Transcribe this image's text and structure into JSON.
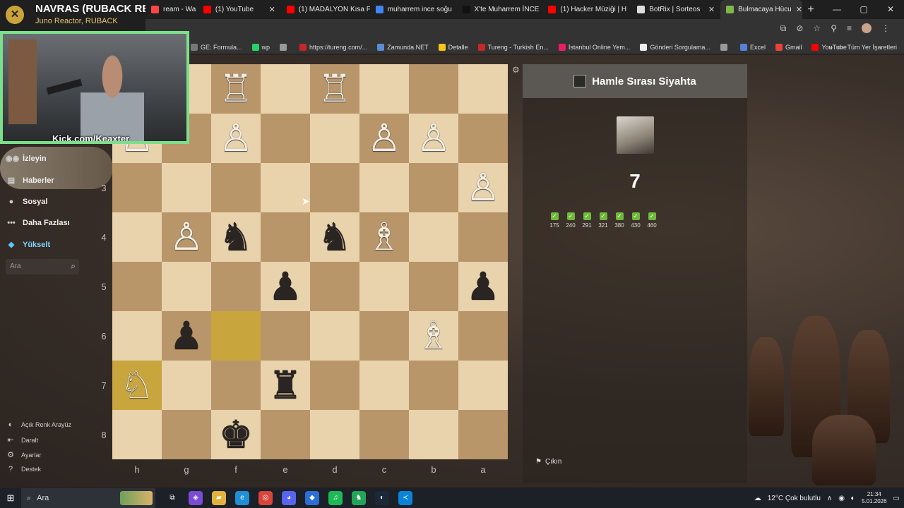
{
  "browser": {
    "tabs": [
      {
        "label": "ream - Wa",
        "icon_color": "#ff4444",
        "active": false
      },
      {
        "label": "(1) YouTube",
        "icon_color": "#ff0000",
        "active": false
      },
      {
        "label": "(1) MADALYON Kısa F",
        "icon_color": "#ff0000",
        "active": false
      },
      {
        "label": "muharrem ince soğu",
        "icon_color": "#4285f4",
        "active": false
      },
      {
        "label": "X'te Muharrem İNCE",
        "icon_color": "#111111",
        "active": false
      },
      {
        "label": "(1) Hacker Müziği | H",
        "icon_color": "#ff0000",
        "active": false
      },
      {
        "label": "BotRix | Sorteos",
        "icon_color": "#dddddd",
        "active": false
      },
      {
        "label": "Bulmacaya Hücu",
        "icon_color": "#81b64c",
        "active": true
      }
    ],
    "new_tab": "+",
    "window_controls": [
      "—",
      "▢",
      "✕"
    ],
    "bookmarks": [
      {
        "label": "GE: Formula...",
        "icon_color": "#777"
      },
      {
        "label": "wp",
        "icon_color": "#25d366"
      },
      {
        "label": "",
        "icon_color": "#999"
      },
      {
        "label": "https://tureng.com/...",
        "icon_color": "#c62828"
      },
      {
        "label": "Zamunda.NET",
        "icon_color": "#5a8dd6"
      },
      {
        "label": "Detalle",
        "icon_color": "#f5c518"
      },
      {
        "label": "Tureng - Turkish En...",
        "icon_color": "#c62828"
      },
      {
        "label": "İstanbul Online Yem...",
        "icon_color": "#e91e63"
      },
      {
        "label": "Gönderi Sorgulama...",
        "icon_color": "#eeeeee"
      },
      {
        "label": "",
        "icon_color": "#999"
      },
      {
        "label": "Excel",
        "icon_color": "#5a7fd6"
      },
      {
        "label": "Gmail",
        "icon_color": "#ea4335"
      },
      {
        "label": "YouTube",
        "icon_color": "#ff0000"
      }
    ],
    "all_bookmarks_label": "Tüm Yer İşaretleri"
  },
  "stream": {
    "title": "NAVRAS (RUBACK REM",
    "subtitle": "Juno Reactor, RUBACK",
    "cam_label": "Kick.com/Keaxter"
  },
  "sidebar": {
    "nav": [
      {
        "label": "İzleyin",
        "icon": "binoculars-icon",
        "glyph": "◉◉"
      },
      {
        "label": "Haberler",
        "icon": "news-icon",
        "glyph": "▤"
      },
      {
        "label": "Sosyal",
        "icon": "social-icon",
        "glyph": "●"
      },
      {
        "label": "Daha Fazlası",
        "icon": "more-icon",
        "glyph": "•••"
      },
      {
        "label": "Yükselt",
        "icon": "diamond-icon",
        "glyph": "◆"
      }
    ],
    "search_placeholder": "Ara",
    "footer": [
      {
        "label": "Açık Renk Arayüz",
        "icon": "theme-icon",
        "glyph": "◐"
      },
      {
        "label": "Daralt",
        "icon": "collapse-icon",
        "glyph": "⇤"
      },
      {
        "label": "Ayarlar",
        "icon": "settings-icon",
        "glyph": "⚙"
      },
      {
        "label": "Destek",
        "icon": "help-icon",
        "glyph": "?"
      }
    ]
  },
  "board": {
    "orientation": "black",
    "ranks": [
      "1",
      "2",
      "3",
      "4",
      "5",
      "6",
      "7",
      "8"
    ],
    "files": [
      "h",
      "g",
      "f",
      "e",
      "d",
      "c",
      "b",
      "a"
    ],
    "highlighted": [
      "f6",
      "h7"
    ],
    "pieces": {
      "f1": "wR",
      "d1": "wR",
      "h2": "wP",
      "f2": "wP",
      "c2": "wP",
      "b2": "wP",
      "a3": "wP",
      "g4": "wP",
      "f4": "bN",
      "d4": "bN",
      "c4": "wB",
      "e5": "bP",
      "a5": "bP",
      "g6": "bP",
      "b6": "wB",
      "h7": "wN",
      "e7": "bR",
      "f8": "bK"
    }
  },
  "panel": {
    "turn_text": "Hamle Sırası Siyahta",
    "streak": "7",
    "solved_ratings": [
      "175",
      "240",
      "291",
      "321",
      "380",
      "430",
      "460"
    ],
    "quit_label": "Çıkın"
  },
  "taskbar": {
    "search_placeholder": "Ara",
    "apps": [
      {
        "name": "task-view-icon",
        "glyph": "⧉",
        "color": "transparent"
      },
      {
        "name": "copilot-icon",
        "glyph": "◈",
        "color": "#7b4bd6"
      },
      {
        "name": "file-explorer-icon",
        "glyph": "▰",
        "color": "#e2b33c"
      },
      {
        "name": "edge-icon",
        "glyph": "e",
        "color": "#1f8fd6"
      },
      {
        "name": "chrome-icon",
        "glyph": "◎",
        "color": "#d9453a"
      },
      {
        "name": "discord-icon",
        "glyph": "◕",
        "color": "#5865f2"
      },
      {
        "name": "app-icon",
        "glyph": "◆",
        "color": "#2b6fd6"
      },
      {
        "name": "spotify-icon",
        "glyph": "♫",
        "color": "#1db954"
      },
      {
        "name": "chess-app-icon",
        "glyph": "♞",
        "color": "#23a559"
      },
      {
        "name": "steam-icon",
        "glyph": "◐",
        "color": "#1b2838"
      },
      {
        "name": "vscode-icon",
        "glyph": "≺",
        "color": "#0a84d6"
      }
    ],
    "weather": "12°C  Çok bulutlu",
    "time": "21:34",
    "date": "5.01.2026"
  }
}
